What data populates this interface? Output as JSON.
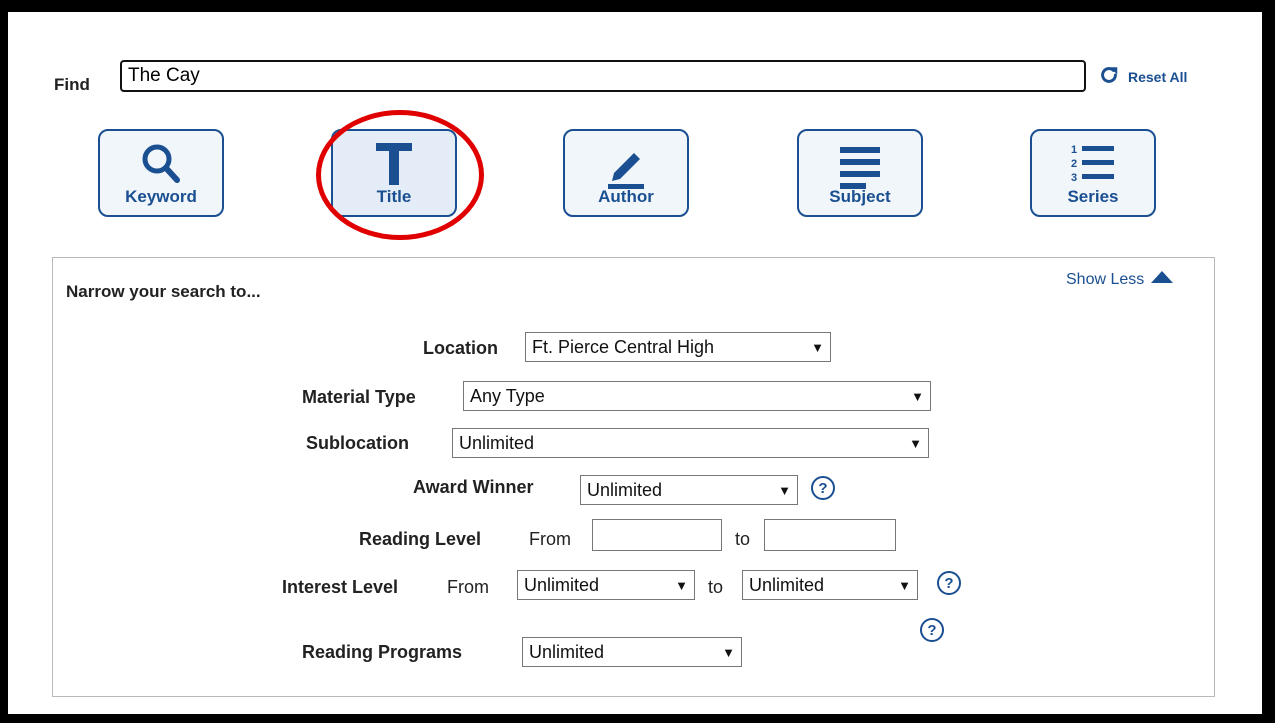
{
  "find": {
    "label": "Find",
    "value": "The Cay"
  },
  "reset_label": "Reset All",
  "search_types": [
    {
      "label": "Keyword",
      "icon": "magnifier-icon"
    },
    {
      "label": "Title",
      "icon": "title-t-icon"
    },
    {
      "label": "Author",
      "icon": "pencil-icon"
    },
    {
      "label": "Subject",
      "icon": "lines-icon"
    },
    {
      "label": "Series",
      "icon": "numbered-list-icon"
    }
  ],
  "narrow": {
    "title": "Narrow your search to...",
    "show_less": "Show Less",
    "location": {
      "label": "Location",
      "value": "Ft. Pierce Central High"
    },
    "material_type": {
      "label": "Material Type",
      "value": "Any Type"
    },
    "sublocation": {
      "label": "Sublocation",
      "value": "Unlimited"
    },
    "award_winner": {
      "label": "Award Winner",
      "value": "Unlimited"
    },
    "reading_level": {
      "label": "Reading Level",
      "from": "From",
      "to": "to"
    },
    "interest_level": {
      "label": "Interest Level",
      "from": "From",
      "from_value": "Unlimited",
      "to": "to",
      "to_value": "Unlimited"
    },
    "reading_programs": {
      "label": "Reading Programs",
      "value": "Unlimited"
    }
  },
  "help_glyph": "?",
  "colors": {
    "accent": "#1a4f91",
    "highlight_circle": "#e00000"
  }
}
